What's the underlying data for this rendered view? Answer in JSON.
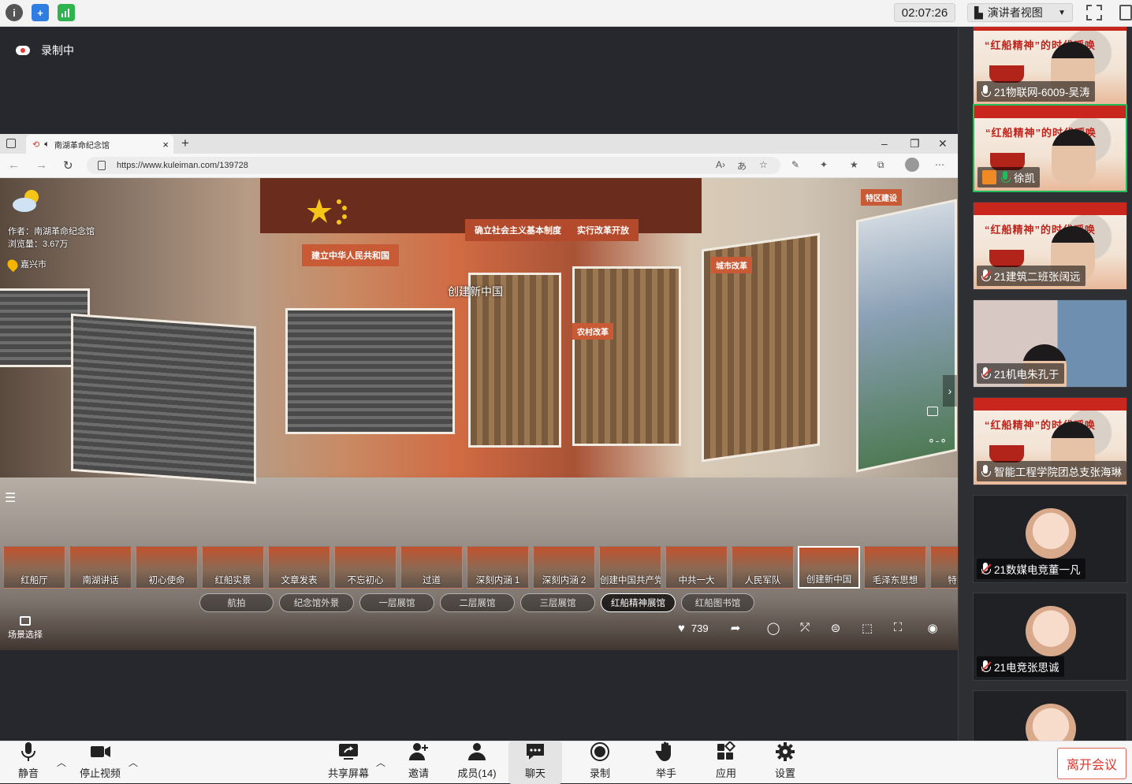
{
  "topbar": {
    "time": "02:07:26",
    "view_label": "演讲者视图",
    "icons": [
      "info-icon",
      "shield-icon",
      "signal-icon",
      "fullscreen-icon",
      "sidebar-toggle-icon"
    ]
  },
  "recording": {
    "label": "录制中"
  },
  "browser": {
    "tab_title": "南湖革命纪念馆",
    "url": "https://www.kuleiman.com/139728",
    "address_icons": [
      "read-aloud-icon",
      "translate-icon",
      "favorite-add-icon",
      "pen-icon",
      "extension-icon",
      "favorites-icon",
      "collections-icon",
      "profile-icon",
      "more-icon"
    ]
  },
  "tour": {
    "author": "作者：南湖革命纪念馆",
    "views": "浏览量：3.67万",
    "location": "嘉兴市",
    "scene_label": "创建新中国",
    "banners": [
      "建立中华人民共和国",
      "确立社会主义基本制度",
      "实行改革开放",
      "农村改革",
      "城市改革",
      "特区建设"
    ],
    "scenes": [
      "红船厅",
      "南湖讲话",
      "初心使命",
      "红船实景",
      "文章发表",
      "不忘初心",
      "过道",
      "深刻内涵 1",
      "深刻内涵 2",
      "创建中国共产党",
      "中共一大",
      "人民军队",
      "创建新中国",
      "毛泽东思想",
      "特区建"
    ],
    "active_scene": 12,
    "groups": [
      "航拍",
      "纪念馆外景",
      "一层展馆",
      "二层展馆",
      "三层展馆",
      "红船精神展馆",
      "红船图书馆"
    ],
    "active_group": 5,
    "scene_select": "场景选择",
    "likes": "739"
  },
  "participants": [
    {
      "name": "21物联网-6009-吴涛",
      "mic": "on",
      "video": "poster"
    },
    {
      "name": "徐凯",
      "mic": "speaking",
      "video": "poster",
      "active": true
    },
    {
      "name": "21建筑二班张阔远",
      "mic": "muted",
      "video": "poster"
    },
    {
      "name": "21机电朱孔于",
      "mic": "muted",
      "video": "room"
    },
    {
      "name": "智能工程学院团总支张海琳",
      "mic": "on",
      "video": "poster"
    },
    {
      "name": "21数媒电竞董一凡",
      "mic": "muted",
      "video": "avatar"
    },
    {
      "name": "21电竞张思诚",
      "mic": "muted",
      "video": "avatar"
    }
  ],
  "poster_text": "“红船精神”的时代呼唤",
  "toolbar": {
    "mute": "静音",
    "stop_video": "停止视频",
    "share": "共享屏幕",
    "invite": "邀请",
    "members": "成员(14)",
    "chat": "聊天",
    "record": "录制",
    "raise_hand": "举手",
    "apps": "应用",
    "settings": "设置",
    "leave": "离开会议"
  }
}
